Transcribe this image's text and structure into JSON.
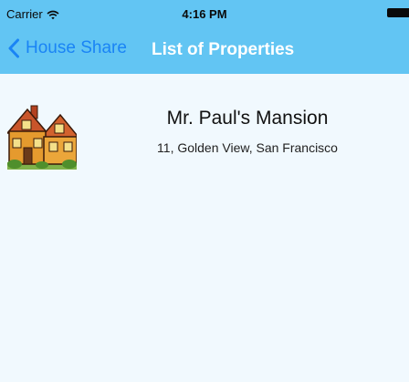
{
  "status_bar": {
    "carrier": "Carrier",
    "time": "4:16 PM",
    "wifi_icon": "wifi-icon",
    "battery_icon": "battery-icon"
  },
  "nav_bar": {
    "back_label": "House Share",
    "back_icon": "chevron-left-icon",
    "title": "List of Properties"
  },
  "properties": [
    {
      "name": "Mr. Paul's Mansion",
      "address": "11, Golden View, San Francisco",
      "thumbnail_icon": "house-icon"
    }
  ],
  "colors": {
    "nav_background": "#62c5f3",
    "back_button": "#1a84f5",
    "title": "#ffffff",
    "content_background": "#f1f9fe"
  }
}
